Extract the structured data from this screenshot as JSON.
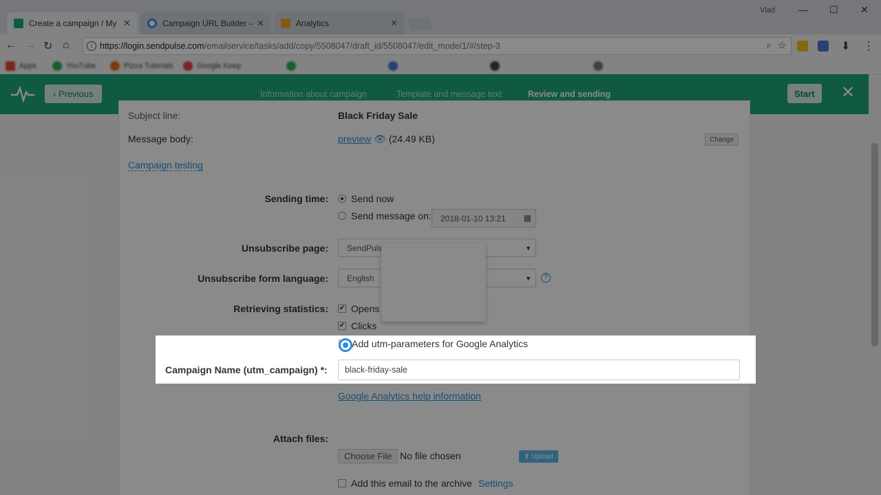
{
  "browser": {
    "user": "Vlad",
    "tabs": [
      {
        "title": "Create a campaign / My",
        "active": true,
        "icon": "sendpulse-favicon"
      },
      {
        "title": "Campaign URL Builder —",
        "active": false,
        "icon": "google-favicon"
      },
      {
        "title": "Analytics",
        "active": false,
        "icon": "analytics-favicon"
      }
    ],
    "url_host": "https://login.sendpulse.com",
    "url_path": "/emailservice/tasks/add/copy/5508047/draft_id/5508047/edit_mode/1/#/step-3",
    "bookmarks": [
      "Apps",
      "YouTube",
      "Pizza Tutorials",
      "Google Keep"
    ]
  },
  "app_header": {
    "previous_label": "‹ Previous",
    "steps": [
      "Information about campaign",
      "Template and message text",
      "Review and sending"
    ],
    "active_step": 2,
    "start_label": "Start",
    "close_label": "✕"
  },
  "form": {
    "subject_label": "Subject line:",
    "subject_value": "Black Friday Sale",
    "body_label": "Message body:",
    "body_preview": "preview",
    "body_size": "(24.49 KB)",
    "change_label": "Change",
    "testing_label": "Campaign testing",
    "sending_time_label": "Sending time:",
    "send_now": "Send now",
    "send_on": "Send message on:",
    "send_on_value": "2018-01-10 13:21",
    "unsub_page_label": "Unsubscribe page:",
    "unsub_page_value": "SendPulse",
    "unsub_lang_label": "Unsubscribe form language:",
    "unsub_lang_value": "English",
    "stats_label": "Retrieving statistics:",
    "stats_opens": "Opens",
    "stats_clicks": "Clicks",
    "utm_label": "Add utm-parameters for Google Analytics",
    "utm_name_label": "Campaign Name (utm_campaign) *:",
    "utm_name_value": "black-friday-sale",
    "ga_help": "Google Analytics help information",
    "attach_label": "Attach files:",
    "choose_file": "Choose File",
    "no_file": "No file chosen",
    "upload_label": "Upload",
    "archive_label": "Add this email to the archive",
    "archive_settings": "Settings"
  }
}
